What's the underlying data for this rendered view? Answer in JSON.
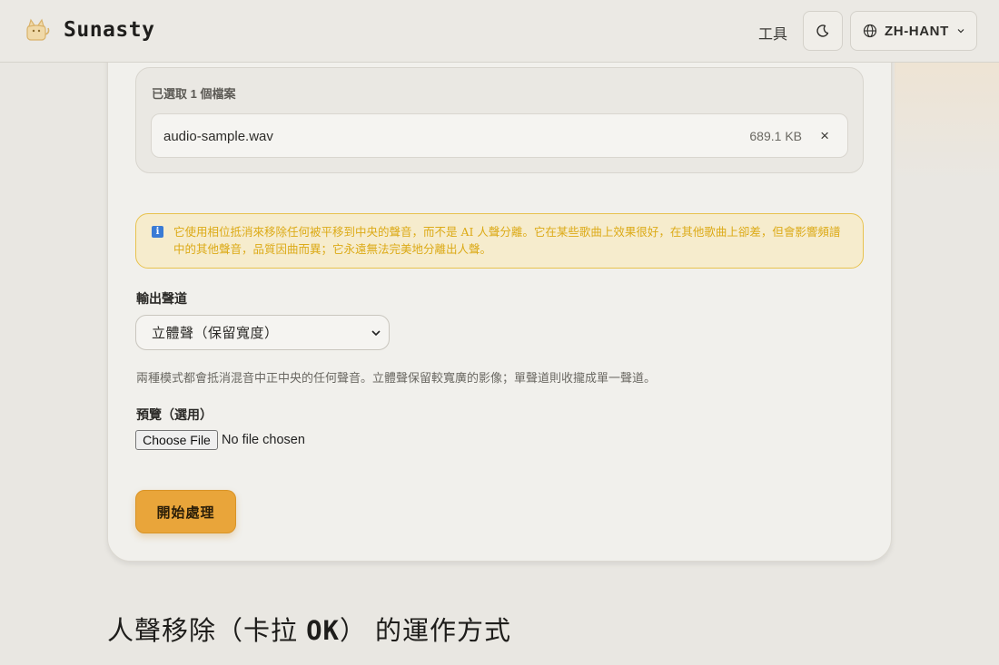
{
  "header": {
    "brand": "Sunasty",
    "tools_link": "工具",
    "language": "ZH-HANT"
  },
  "files": {
    "title": "已選取 1 個檔案",
    "items": [
      {
        "name": "audio-sample.wav",
        "size": "689.1 KB",
        "remove": "×"
      }
    ]
  },
  "warning": {
    "text": "它使用相位抵消來移除任何被平移到中央的聲音，而不是 AI 人聲分離。它在某些歌曲上效果很好，在其他歌曲上卻差，但會影響頻譜中的其他聲音，品質因曲而異；它永遠無法完美地分離出人聲。"
  },
  "form": {
    "output_label": "輸出聲道",
    "output_selected": "立體聲（保留寬度）",
    "hint": "兩種模式都會抵消混音中正中央的任何聲音。立體聲保留較寬廣的影像；單聲道則收攏成單一聲道。",
    "preview_label": "預覽（選用）",
    "choose_file": "Choose File",
    "no_file": "No file chosen",
    "start_button": "開始處理"
  },
  "section": {
    "heading_part1": "人聲移除（卡拉 ",
    "heading_part2": "OK",
    "heading_part3": "） 的運作方式"
  },
  "colors": {
    "accent": "#e9a53a",
    "warning_border": "#e8c24e",
    "warning_text": "#dcaa17",
    "info_icon": "#3a7bd5"
  },
  "icons": {
    "logo": "cat-logo-icon",
    "theme": "moon-icon",
    "language": "globe-icon",
    "dropdown": "chevron-down-icon",
    "info": "info-icon",
    "remove": "close-icon"
  }
}
